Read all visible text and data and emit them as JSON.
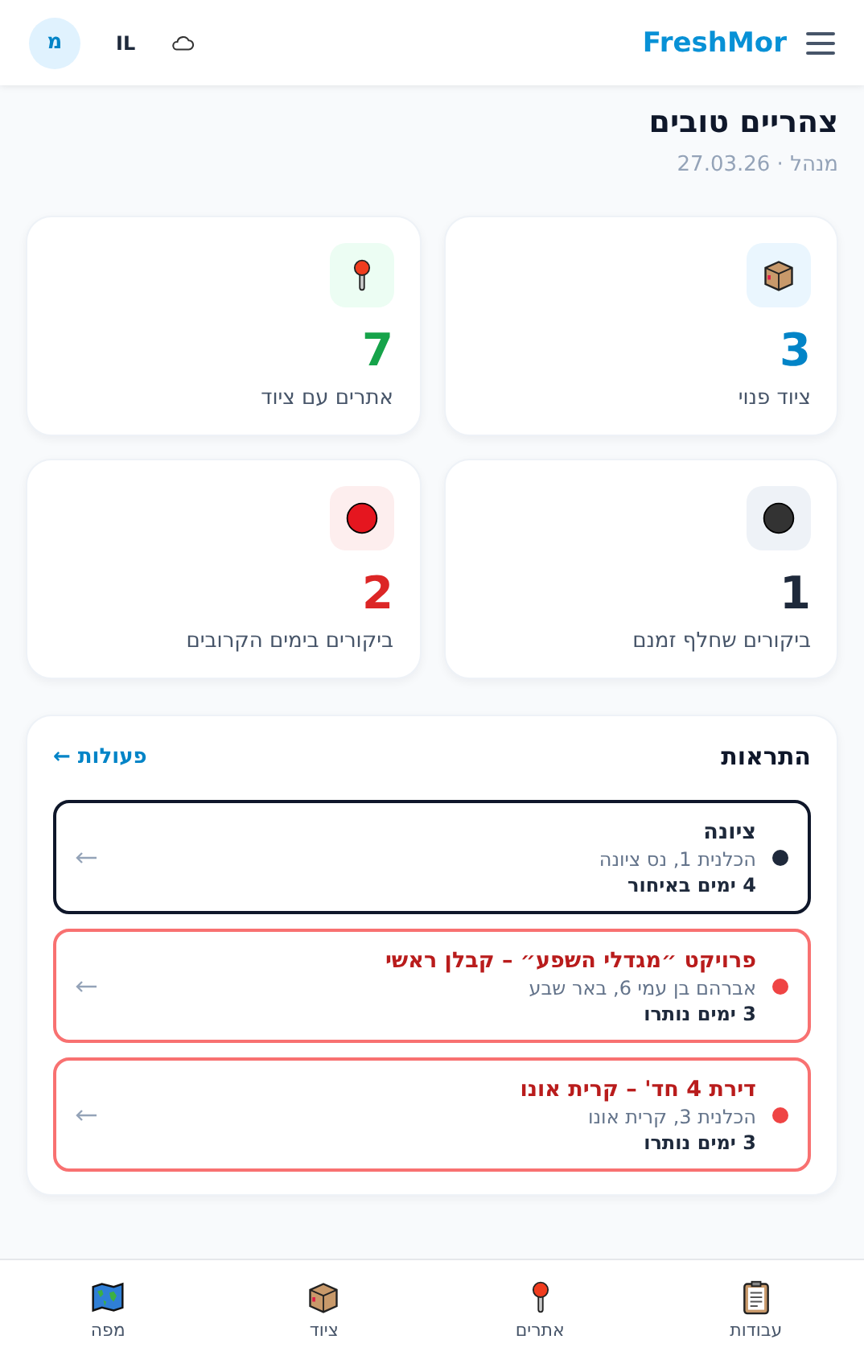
{
  "header": {
    "brand": "FreshMor",
    "locale": "IL",
    "avatar": "מ"
  },
  "greeting": {
    "title": "צהריים טובים",
    "subtitle": "מנהל · 27.03.26"
  },
  "stats": [
    {
      "value": "3",
      "label": "ציוד פנוי",
      "kind": "box",
      "color": "#0284c7"
    },
    {
      "value": "7",
      "label": "אתרים עם ציוד",
      "kind": "pin",
      "color": "#16a34a"
    },
    {
      "value": "1",
      "label": "ביקורים שחלף זמנם",
      "kind": "dark-dot",
      "color": "#1e293b"
    },
    {
      "value": "2",
      "label": "ביקורים בימים הקרובים",
      "kind": "red-dot",
      "color": "#dc2626"
    }
  ],
  "alerts": {
    "title": "התראות",
    "link": "פעולות ←",
    "items": [
      {
        "kind": "overdue",
        "title": "ציונה",
        "address": "הכלנית 1, נס ציונה",
        "status": "4 ימים באיחור"
      },
      {
        "kind": "upcoming",
        "title": "פרויקט ״מגדלי השפע״ – קבלן ראשי",
        "address": "אברהם בן עמי 6, באר שבע",
        "status": "3 ימים נותרו"
      },
      {
        "kind": "upcoming",
        "title": "דירת 4 חד' – קרית אונו",
        "address": "הכלנית 3, קרית אונו",
        "status": "3 ימים נותרו"
      }
    ]
  },
  "nav": [
    {
      "label": "עבודות",
      "kind": "clipboard"
    },
    {
      "label": "אתרים",
      "kind": "pin"
    },
    {
      "label": "ציוד",
      "kind": "box"
    },
    {
      "label": "מפה",
      "kind": "map"
    }
  ]
}
